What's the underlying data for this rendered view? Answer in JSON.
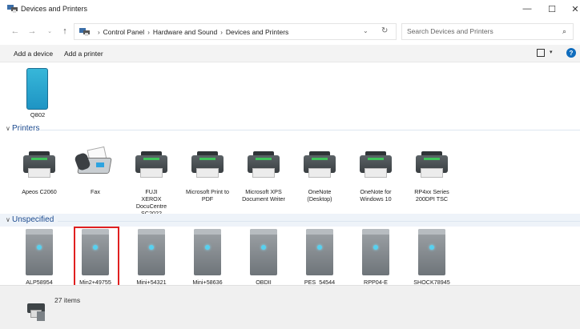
{
  "window": {
    "title": "Devices and Printers",
    "minimize_glyph": "—",
    "maximize_glyph": "☐",
    "close_glyph": "✕"
  },
  "nav": {
    "back_glyph": "←",
    "forward_glyph": "→",
    "recent_glyph": "⌄",
    "up_glyph": "↑"
  },
  "address": {
    "crumbs": [
      "Control Panel",
      "Hardware and Sound",
      "Devices and Printers"
    ],
    "separator": "›",
    "dropdown_glyph": "⌄",
    "refresh_glyph": "↻"
  },
  "search": {
    "placeholder": "Search Devices and Printers",
    "icon_glyph": "⌕"
  },
  "commands": {
    "add_device": "Add a device",
    "add_printer": "Add a printer",
    "view_dropdown_glyph": "▾",
    "help_glyph": "?"
  },
  "devices_top": [
    {
      "label": "Q802",
      "icon": "phone-icon"
    }
  ],
  "sections": {
    "printers": {
      "label": "Printers",
      "chevron": "∨"
    },
    "unspecified": {
      "label": "Unspecified",
      "chevron": "∨"
    }
  },
  "printers": [
    {
      "label": "Apeos C2060",
      "icon": "printer-icon"
    },
    {
      "label": "Fax",
      "icon": "fax-icon"
    },
    {
      "label": "FUJI XEROX DocuCentre SC2022",
      "icon": "printer-icon"
    },
    {
      "label": "Microsoft Print to PDF",
      "icon": "printer-icon"
    },
    {
      "label": "Microsoft XPS Document Writer",
      "icon": "printer-icon"
    },
    {
      "label": "OneNote (Desktop)",
      "icon": "printer-icon"
    },
    {
      "label": "OneNote for Windows 10",
      "icon": "printer-icon"
    },
    {
      "label": "RP4xx Series 200DPI TSC",
      "icon": "printer-icon"
    }
  ],
  "unspecified": [
    {
      "label": "ALP58954",
      "icon": "tower-icon"
    },
    {
      "label": "Min2+49755",
      "icon": "tower-icon",
      "selected": true
    },
    {
      "label": "Mini+54321",
      "icon": "tower-icon"
    },
    {
      "label": "Mini+58636",
      "icon": "tower-icon"
    },
    {
      "label": "OBDII",
      "icon": "tower-icon"
    },
    {
      "label": "PES_54544",
      "icon": "tower-icon"
    },
    {
      "label": "RPP04-E",
      "icon": "tower-icon"
    },
    {
      "label": "SHOCK78945",
      "icon": "tower-icon"
    }
  ],
  "details": {
    "count": "27 items",
    "icon": "devices-printers-icon"
  },
  "colors": {
    "accent": "#0f6cbd",
    "section_header": "#1b4a8f",
    "selection_outline": "#e02020",
    "printer_stripe": "#3fc35a",
    "phone": "#1e94c4"
  }
}
